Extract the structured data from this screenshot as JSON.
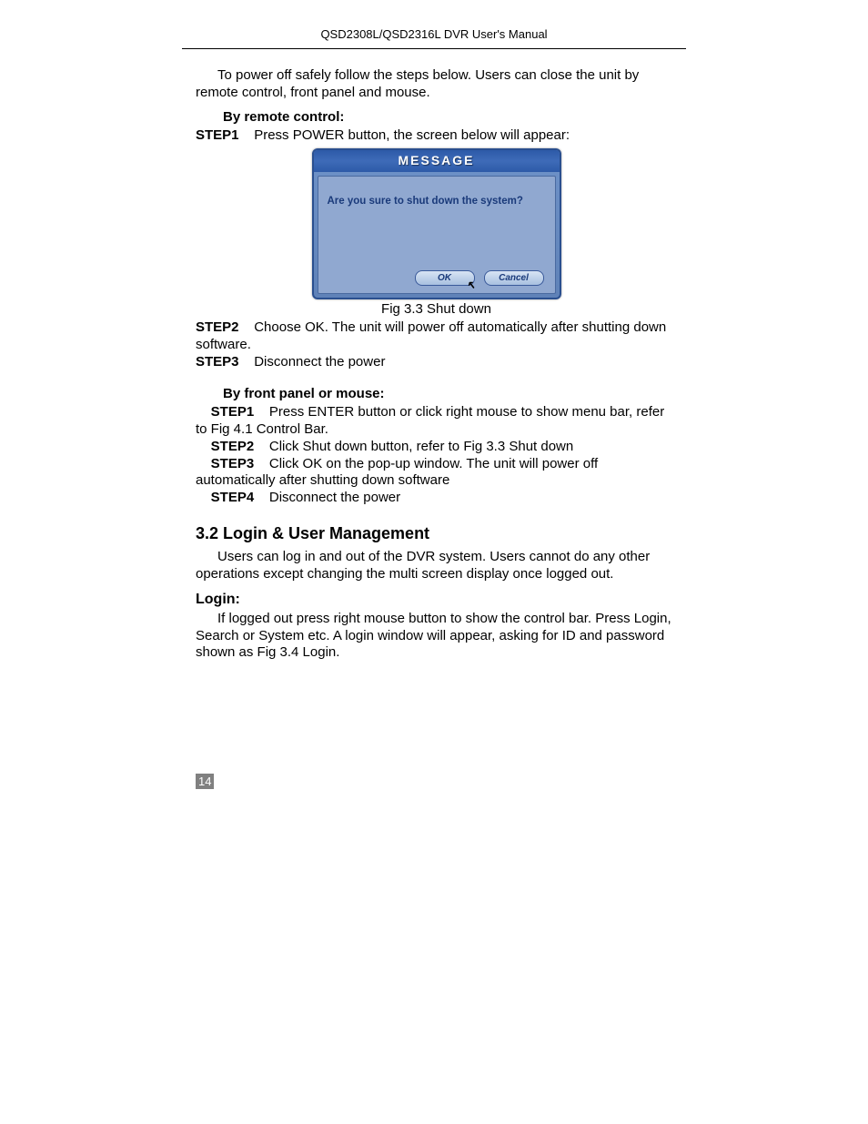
{
  "header": "QSD2308L/QSD2316L DVR User's Manual",
  "intro": "To power off safely follow the steps below. Users can close the unit by remote control, front panel and mouse.",
  "remote": {
    "heading": "By remote control:",
    "step1_label": "STEP1",
    "step1_text": "Press POWER button, the screen below will appear:",
    "dialog_title": "MESSAGE",
    "dialog_msg": "Are you sure to shut down the system?",
    "ok": "OK",
    "cancel": "Cancel",
    "caption": "Fig 3.3 Shut down",
    "step2_label": "STEP2",
    "step2_text": "Choose OK. The unit will power off automatically after shutting down software.",
    "step3_label": "STEP3",
    "step3_text": "Disconnect the power"
  },
  "panel": {
    "heading": "By front panel or mouse:",
    "step1_label": "STEP1",
    "step1_text": "Press ENTER button or click right mouse to show menu bar, refer to Fig 4.1 Control Bar.",
    "step2_label": "STEP2",
    "step2_text": "Click Shut down button, refer to Fig 3.3 Shut down",
    "step3_label": "STEP3",
    "step3_text": "Click OK on the pop-up window. The unit will power off automatically after shutting down software",
    "step4_label": "STEP4",
    "step4_text": "Disconnect the power"
  },
  "section": {
    "heading": "3.2 Login & User Management",
    "intro": "Users can log in and out of the DVR system. Users cannot do any other operations except changing the multi screen display once logged out.",
    "login_head": "Login:",
    "login_body": "If logged out press right mouse button to show the control bar. Press Login, Search or System etc. A login window will appear, asking for ID and password shown as Fig 3.4 Login."
  },
  "page_number": "14"
}
